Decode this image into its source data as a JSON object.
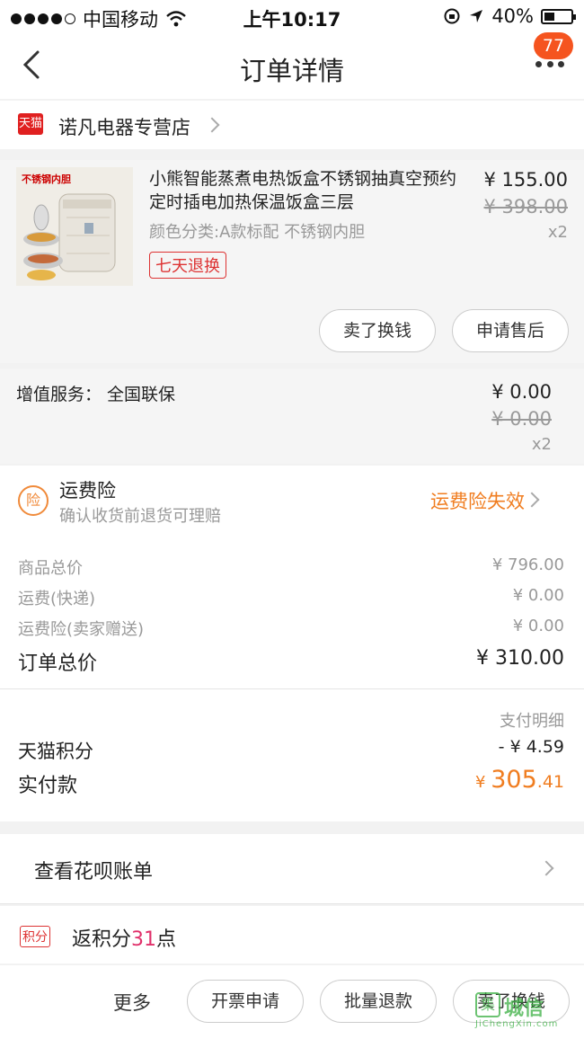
{
  "status_bar": {
    "carrier": "中国移动",
    "time": "上午10:17",
    "battery_text": "40%",
    "battery_level": 0.4
  },
  "nav": {
    "title": "订单详情",
    "badge_count": "77"
  },
  "store": {
    "logo_text": "天猫",
    "name": "诺凡电器专营店"
  },
  "product": {
    "image_caption": "不锈钢内胆",
    "title": "小熊智能蒸煮电热饭盒不锈钢抽真空预约定时插电加热保温饭盒三层",
    "spec": "颜色分类:A款标配 不锈钢内胆",
    "tag": "七天退换",
    "price": "¥ 155.00",
    "original_price": "¥ 398.00",
    "quantity": "x2",
    "buttons": [
      "卖了换钱",
      "申请售后"
    ]
  },
  "service": {
    "label": "增值服务：  全国联保",
    "price": "¥ 0.00",
    "original_price": "¥ 0.00",
    "quantity": "x2"
  },
  "insurance": {
    "icon_text": "险",
    "title": "运费险",
    "subtitle": "确认收货前退货可理赔",
    "status": "运费险失效"
  },
  "totals": {
    "goods_label": "商品总价",
    "goods_value": "¥ 796.00",
    "shipping_label": "运费(快递)",
    "shipping_value": "¥ 0.00",
    "ins_label": "运费险(卖家赠送)",
    "ins_value": "¥ 0.00",
    "order_total_label": "订单总价",
    "order_total_value": "¥ 310.00",
    "pay_detail_label": "支付明细",
    "points_label": "天猫积分",
    "points_value": "- ¥ 4.59",
    "paid_label": "实付款",
    "paid_currency": "¥ ",
    "paid_int": "305",
    "paid_dec": ".41"
  },
  "huabei": {
    "label": "查看花呗账单"
  },
  "points": {
    "icon_text": "积分",
    "prefix": "返积分",
    "number": "31",
    "suffix": "点"
  },
  "bottom": {
    "more_label": "更多",
    "buttons": [
      "开票申请",
      "批量退款",
      "卖了换钱"
    ]
  },
  "watermark": {
    "box_char": "集",
    "text": "城信",
    "url": "JiChengXin.com"
  },
  "colors": {
    "accent_orange": "#f07d20",
    "badge": "#f5541f",
    "tmall_red": "#e02020",
    "points_pink": "#e0306a"
  }
}
